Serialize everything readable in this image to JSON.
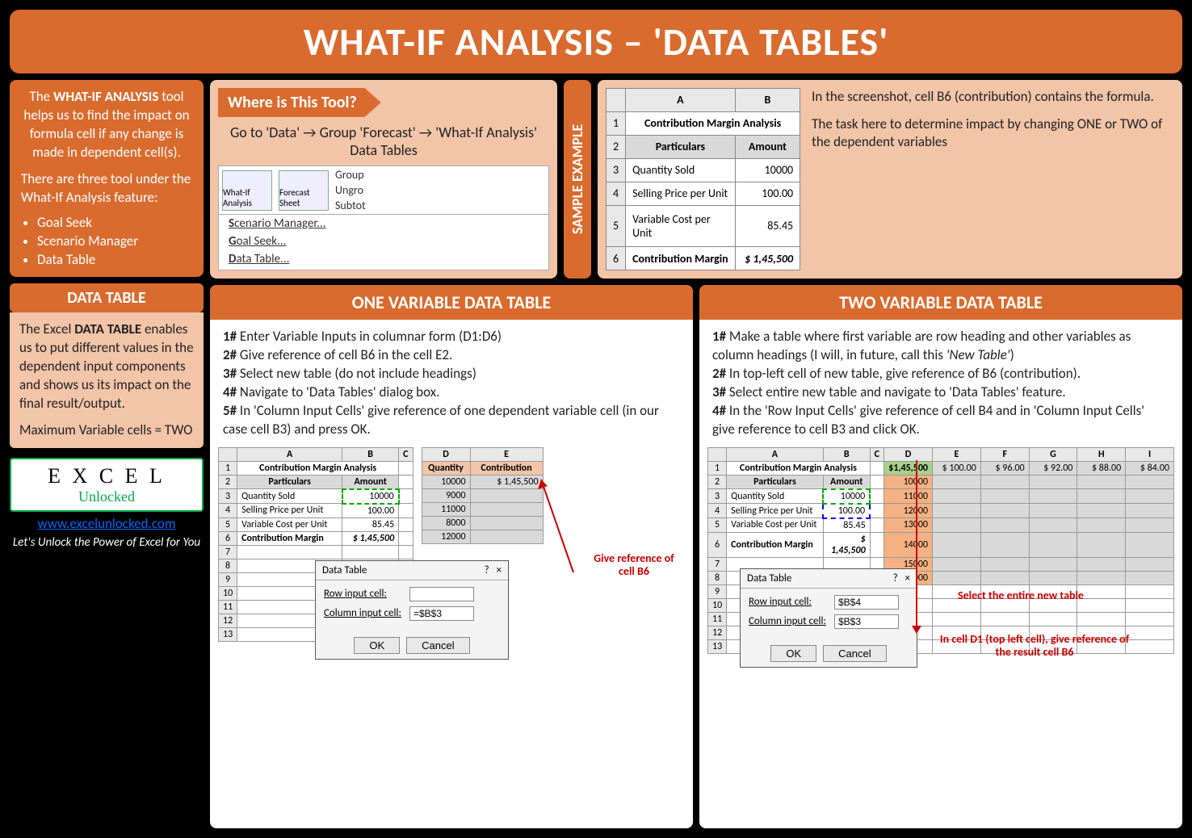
{
  "title": "WHAT-IF ANALYSIS – 'DATA TABLES'",
  "intro": {
    "p1_a": "The ",
    "p1_b": "WHAT-IF ANALYSIS",
    "p1_c": " tool helps us to find the impact on formula cell if any change is made in dependent cell(s).",
    "p2": "There are three tool under the What-If Analysis feature:",
    "li1": "Goal Seek",
    "li2": "Scenario Manager",
    "li3": "Data Table"
  },
  "dt": {
    "head": "DATA TABLE",
    "p1_a": "The Excel ",
    "p1_b": "DATA TABLE",
    "p1_c": " enables us to put different values in the dependent input components and shows us its impact on the final result/output.",
    "p2": "Maximum Variable cells = TWO"
  },
  "logo": {
    "top": "E X C E L",
    "sub": "Unlocked",
    "url": "www.excelunlocked.com",
    "tag": "Let's Unlock the Power of Excel for You"
  },
  "where": {
    "tab": "Where is This Tool?",
    "path": "Go to 'Data' → Group 'Forecast' → 'What-If Analysis' Data Tables",
    "ribbon": {
      "whatif": "What-If Analysis",
      "forecast": "Forecast Sheet",
      "group": "Group",
      "ungroup": "Ungro",
      "subtotal": "Subtot",
      "m1": "Scenario Manager...",
      "m2": "Goal Seek...",
      "m3": "Data Table..."
    }
  },
  "sample": {
    "label": "SAMPLE EXAMPLE",
    "table": {
      "title": "Contribution Margin Analysis",
      "h_part": "Particulars",
      "h_amt": "Amount",
      "r1": "Quantity Sold",
      "v1": "10000",
      "r2": "Selling Price per Unit",
      "v2": "100.00",
      "r3": "Variable Cost per Unit",
      "v3": "85.45",
      "r4": "Contribution Margin",
      "v4": "$  1,45,500"
    },
    "txt1": "In the screenshot, cell B6 (contribution) contains the formula.",
    "txt2": "The task here to determine impact by changing ONE or TWO of the dependent variables"
  },
  "one": {
    "title": "ONE VARIABLE DATA TABLE",
    "s1a": "1#",
    "s1b": " Enter Variable Inputs in columnar form (D1:D6)",
    "s2a": "2#",
    "s2b": " Give reference of cell B6 in the cell E2.",
    "s3a": "3#",
    "s3b": " Select new table (do not include headings)",
    "s4a": "4#",
    "s4b": " Navigate to 'Data Tables' dialog box.",
    "s5a": "5#",
    "s5b": " In 'Column Input Cells' give reference of one dependent variable cell (in our case cell B3) and press OK.",
    "dcol": {
      "h": "Quantity",
      "c": "Contribution",
      "q1": "10000",
      "cv": "$    1,45,500",
      "q2": "9000",
      "q3": "11000",
      "q4": "8000",
      "q5": "12000"
    },
    "dlg": {
      "title": "Data Table",
      "row": "Row input cell:",
      "col": "Column input cell:",
      "colv": "=$B$3",
      "ok": "OK",
      "cancel": "Cancel"
    },
    "note": "Give reference of cell B6"
  },
  "two": {
    "title": "TWO VARIABLE DATA TABLE",
    "s1a": "1#",
    "s1b": " Make a table where first variable are row heading and other variables as column headings (I will, in future, call this ",
    "s1c": "'New Table'",
    "s1d": ")",
    "s2a": "2#",
    "s2b": " In top-left cell of new table, give reference of B6 (contribution).",
    "s3a": "3#",
    "s3b": " Select entire new table and navigate to 'Data Tables' feature.",
    "s4a": "4#",
    "s4b": " In the 'Row Input Cells' give reference of cell B4 and in 'Column Input Cells' give reference to cell B3 and click OK.",
    "grid": {
      "d1": "$1,45,500",
      "e1": "$  100.00",
      "f1": "$    96.00",
      "g1": "$    92.00",
      "h1": "$    88.00",
      "i1": "$    84.00",
      "d2": "10000",
      "d3": "11000",
      "d4": "12000",
      "d5": "13000",
      "d6": "14000",
      "d7": "15000",
      "d8": "16000"
    },
    "dlg": {
      "title": "Data Table",
      "row": "Row input cell:",
      "rowv": "$B$4",
      "col": "Column input cell:",
      "colv": "$B$3",
      "ok": "OK",
      "cancel": "Cancel"
    },
    "note1": "Select the entire new table",
    "note2": "In cell D1 (top left cell), give reference of the result cell B6"
  }
}
